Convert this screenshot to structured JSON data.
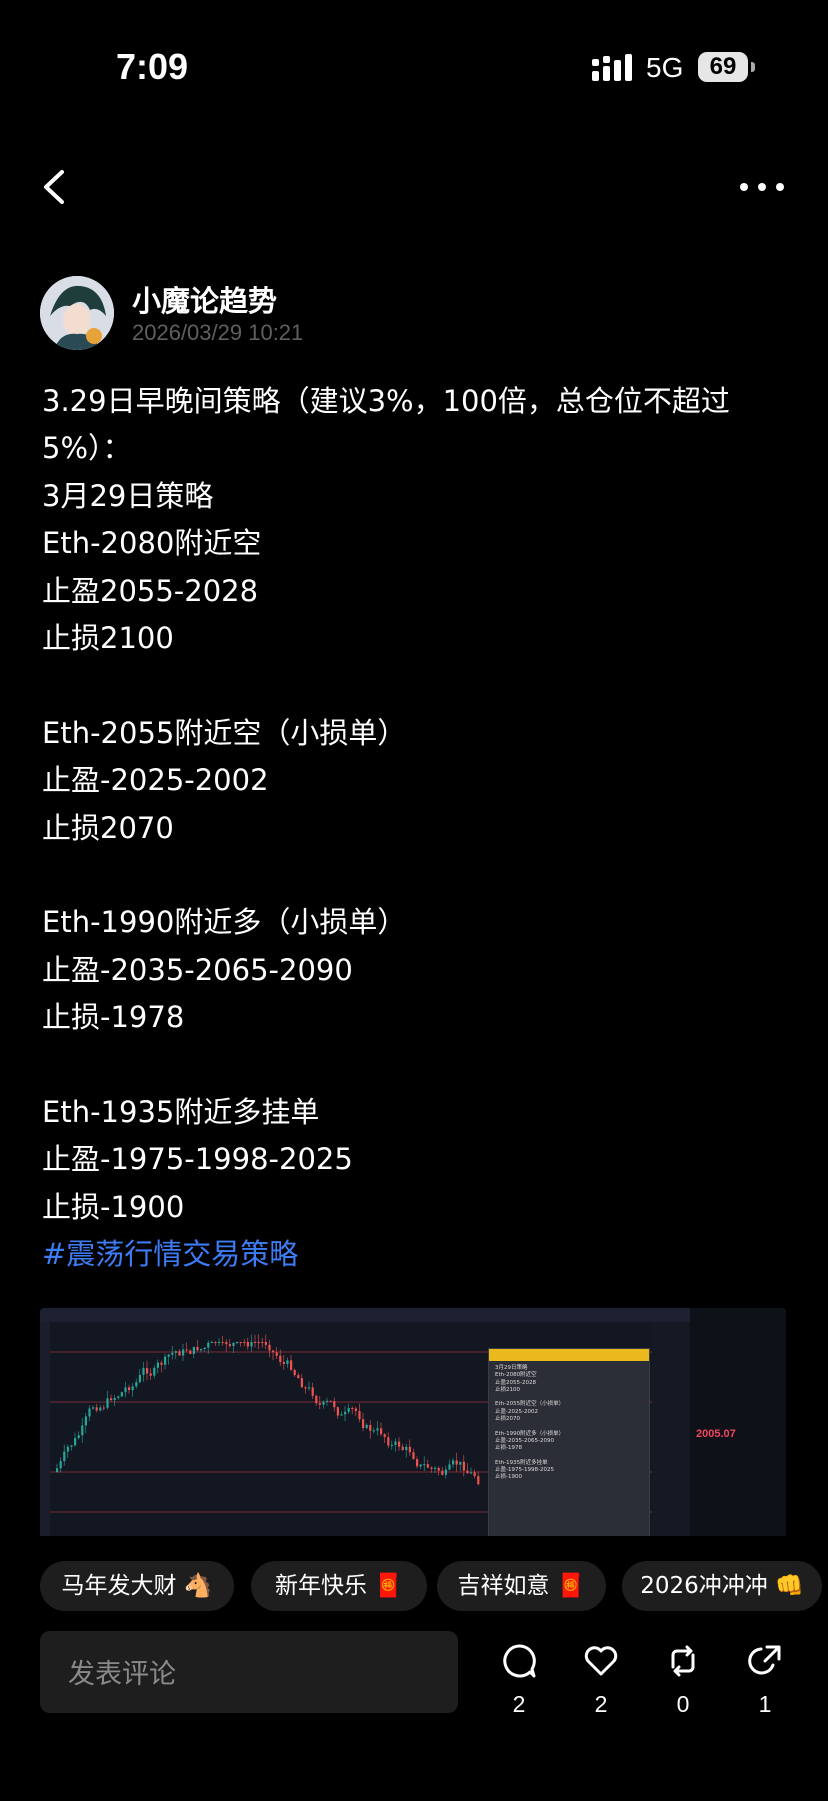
{
  "status_bar": {
    "time": "7:09",
    "network": "5G",
    "battery": "69"
  },
  "author": {
    "name": "小魔论趋势",
    "time": "2026/03/29 10:21"
  },
  "post": {
    "lines": [
      "3.29日早晚间策略（建议3%，100倍，总仓位不超过",
      "5%）：",
      "3月29日策略",
      "Eth-2080附近空",
      "止盈2055-2028",
      "止损2100",
      "",
      "Eth-2055附近空（小损单）",
      "止盈-2025-2002",
      "止损2070",
      "",
      "Eth-1990附近多（小损单）",
      "止盈-2035-2065-2090",
      "止损-1978",
      "",
      "Eth-1935附近多挂单",
      "止盈-1975-1998-2025",
      "止损-1900"
    ],
    "hashtag": "#震荡行情交易策略"
  },
  "attached_image": {
    "note_text": "3月29日策略\nEth-2080附近空\n止盈2055-2028\n止损2100\n\nEth-2055附近空（小损单）\n止盈-2025-2002\n止损2070\n\nEth-1990附近多（小损单）\n止盈-2035-2065-2090\n止损-1978\n\nEth-1935附近多挂单\n止盈-1975-1998-2025\n止损-1900",
    "price": "2005.07"
  },
  "chips": [
    "马年发大财 🐴",
    "新年快乐 🧧",
    "吉祥如意 🧧",
    "2026冲冲冲 👊"
  ],
  "comment_placeholder": "发表评论",
  "actions": {
    "comments": "2",
    "likes": "2",
    "reposts": "0",
    "shares": "1"
  }
}
